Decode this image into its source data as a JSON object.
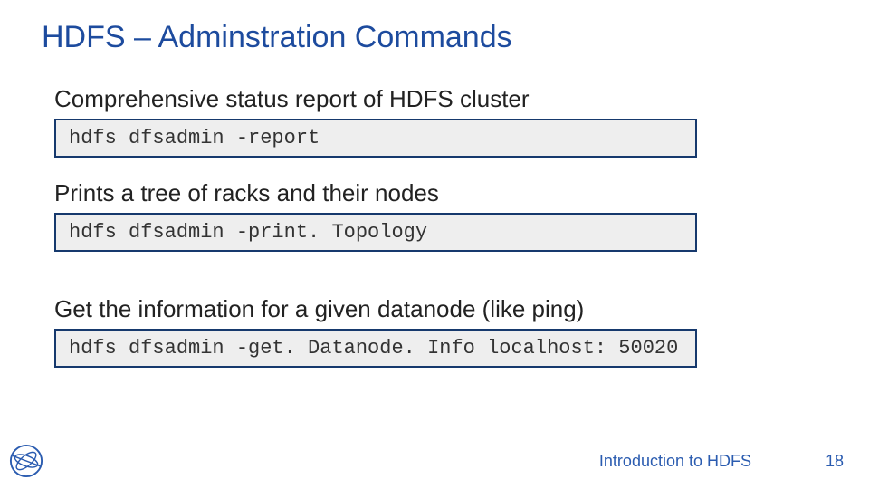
{
  "title": "HDFS – Adminstration Commands",
  "sections": [
    {
      "description": "Comprehensive status report of HDFS cluster",
      "command": "hdfs dfsadmin -report"
    },
    {
      "description": "Prints a tree of racks and their nodes",
      "command": "hdfs dfsadmin -print. Topology"
    },
    {
      "description": "Get the information for a given datanode (like ping)",
      "command": "hdfs dfsadmin -get. Datanode. Info localhost: 50020"
    }
  ],
  "footer": {
    "title": "Introduction to HDFS",
    "page": "18"
  },
  "logo_name": "cern-logo"
}
